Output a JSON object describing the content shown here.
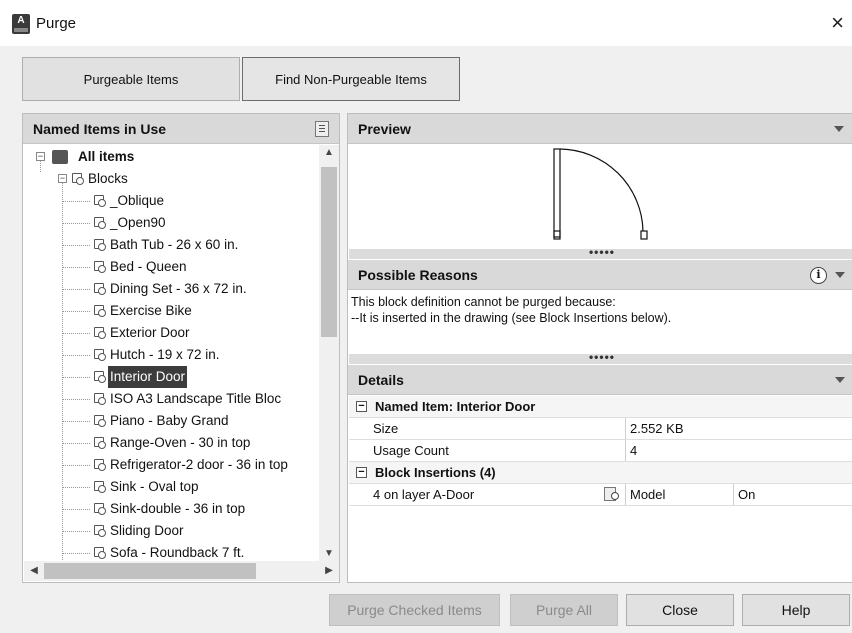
{
  "window": {
    "title": "Purge",
    "close_glyph": "×"
  },
  "tabs": {
    "purgeable": "Purgeable Items",
    "non_purgeable": "Find Non-Purgeable Items"
  },
  "left_panel": {
    "header": "Named Items in Use"
  },
  "tree": {
    "root": "All items",
    "group": "Blocks",
    "items": [
      "_Oblique",
      "_Open90",
      "Bath Tub - 26 x 60 in.",
      "Bed - Queen",
      "Dining Set - 36 x 72 in.",
      "Exercise Bike",
      "Exterior Door",
      "Hutch - 19 x 72 in.",
      "Interior Door",
      "ISO A3 Landscape Title Bloc",
      "Piano - Baby Grand",
      "Range-Oven - 30 in top",
      "Refrigerator-2 door - 36 in top",
      "Sink - Oval top",
      "Sink-double - 36 in top",
      "Sliding Door",
      "Sofa - Roundback 7 ft."
    ],
    "selected": "Interior Door"
  },
  "preview": {
    "header": "Preview"
  },
  "reasons": {
    "header": "Possible Reasons",
    "line1": "This block definition cannot be purged because:",
    "line2": "--It is inserted in the drawing (see Block Insertions below)."
  },
  "grip": "•••••",
  "details": {
    "header": "Details",
    "named_item": "Named Item: Interior Door",
    "size_label": "Size",
    "size_value": "2.552 KB",
    "usage_label": "Usage Count",
    "usage_value": "4",
    "insertions_header": "Block Insertions (4)",
    "insertion_label": "4 on layer A-Door",
    "insertion_space": "Model",
    "insertion_state": "On"
  },
  "footer": {
    "purge_checked": "Purge Checked Items",
    "purge_all": "Purge All",
    "close": "Close",
    "help": "Help"
  },
  "icons": [
    "autocad-app-icon",
    "sort-icon",
    "info-icon",
    "lookup-icon",
    "block-icon"
  ]
}
